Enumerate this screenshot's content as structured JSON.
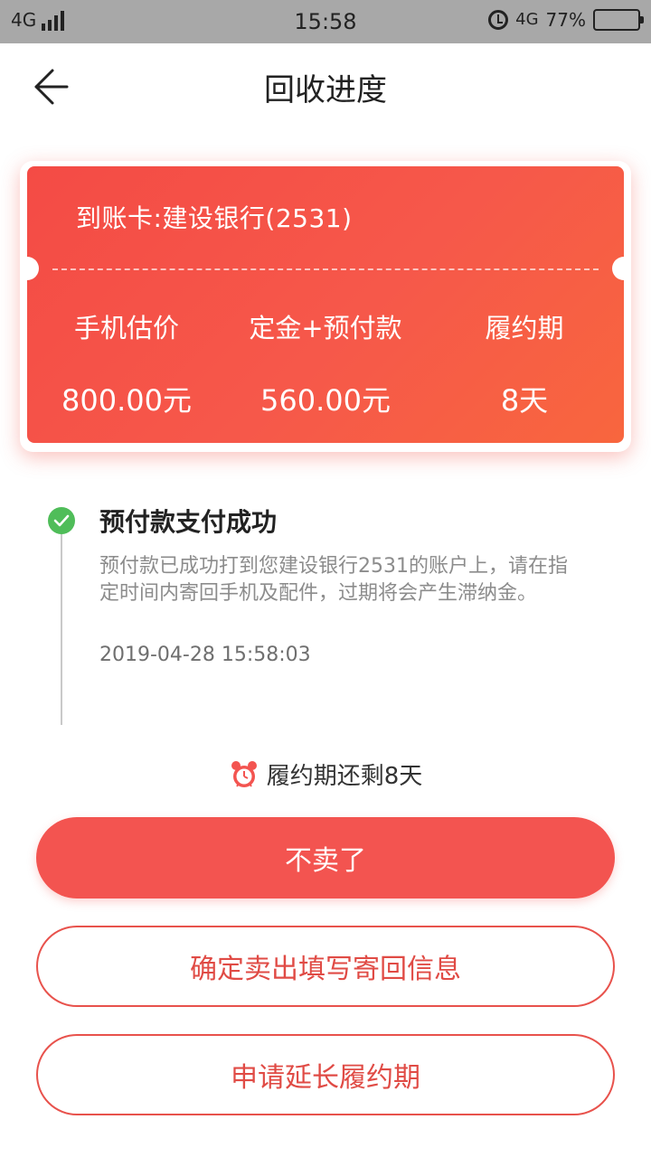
{
  "status_bar": {
    "network": "4G",
    "time": "15:58",
    "network_right": "4G",
    "battery": "77%",
    "battery_level": 0.77
  },
  "header": {
    "title": "回收进度",
    "back_icon": "arrow-left-icon"
  },
  "card": {
    "account": "到账卡:建设银行(2531)",
    "columns": [
      {
        "label": "手机估价",
        "value": "800.00元"
      },
      {
        "label": "定金+预付款",
        "value": "560.00元"
      },
      {
        "label": "履约期",
        "value": "8天"
      }
    ],
    "colors": {
      "start": "#f44b45",
      "end": "#f8663e"
    }
  },
  "timeline": {
    "status_icon": "check-circle-icon",
    "status_color": "#4fbd59",
    "title": "预付款支付成功",
    "description": "预付款已成功打到您建设银行2531的账户上，请在指定时间内寄回手机及配件，过期将会产生滞纳金。",
    "time": "2019-04-28 15:58:03"
  },
  "remaining": {
    "icon": "alarm-clock-icon",
    "text": "履约期还剩8天"
  },
  "actions": {
    "cancel": "不卖了",
    "confirm_sell": "确定卖出填写寄回信息",
    "extend": "申请延长履约期",
    "accent": "#f35450"
  }
}
